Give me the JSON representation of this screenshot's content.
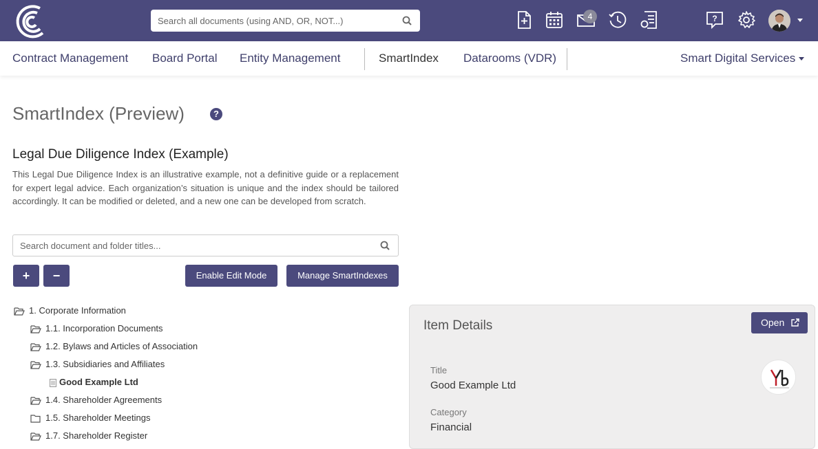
{
  "colors": {
    "brand": "#4b4a7d",
    "panel_bg": "#efeeee"
  },
  "topbar": {
    "search_placeholder": "Search all documents (using AND, OR, NOT...)",
    "icons": [
      "new-document-icon",
      "calendar-icon",
      "mail-icon",
      "history-icon",
      "report-icon",
      "help-chat-icon",
      "settings-icon"
    ],
    "mail_badge": "4"
  },
  "nav": {
    "items": [
      "Contract Management",
      "Board Portal",
      "Entity Management",
      "SmartIndex",
      "Datarooms (VDR)"
    ],
    "org_menu": "Smart Digital Services"
  },
  "main": {
    "page_title": "SmartIndex (Preview)",
    "help_glyph": "?",
    "index_title": "Legal Due Diligence Index (Example)",
    "description": "This Legal Due Diligence Index is an illustrative example, not a definitive guide or a replacement for expert legal advice. Each organization’s situation is unique and the index should be tailored accordingly. It can be modified or deleted, and a new one can be developed from scratch.",
    "tree_search_placeholder": "Search document and folder titles...",
    "expand_label": "+",
    "collapse_label": "−",
    "edit_mode_label": "Enable Edit Mode",
    "manage_label": "Manage SmartIndexes"
  },
  "tree": [
    {
      "label": "1. Corporate Information",
      "type": "folder-open"
    },
    {
      "label": "1.1. Incorporation Documents",
      "type": "folder-open"
    },
    {
      "label": "1.2. Bylaws and Articles of Association",
      "type": "folder-open"
    },
    {
      "label": "1.3. Subsidiaries and Affiliates",
      "type": "folder-open"
    },
    {
      "label": "Good Example Ltd",
      "type": "document"
    },
    {
      "label": "1.4. Shareholder Agreements",
      "type": "folder-open"
    },
    {
      "label": "1.5. Shareholder Meetings",
      "type": "folder"
    },
    {
      "label": "1.7. Shareholder Register",
      "type": "folder-open"
    }
  ],
  "details": {
    "heading": "Item Details",
    "open_label": "Open",
    "title_label": "Title",
    "title_value": "Good Example Ltd",
    "category_label": "Category",
    "category_value": "Financial"
  }
}
